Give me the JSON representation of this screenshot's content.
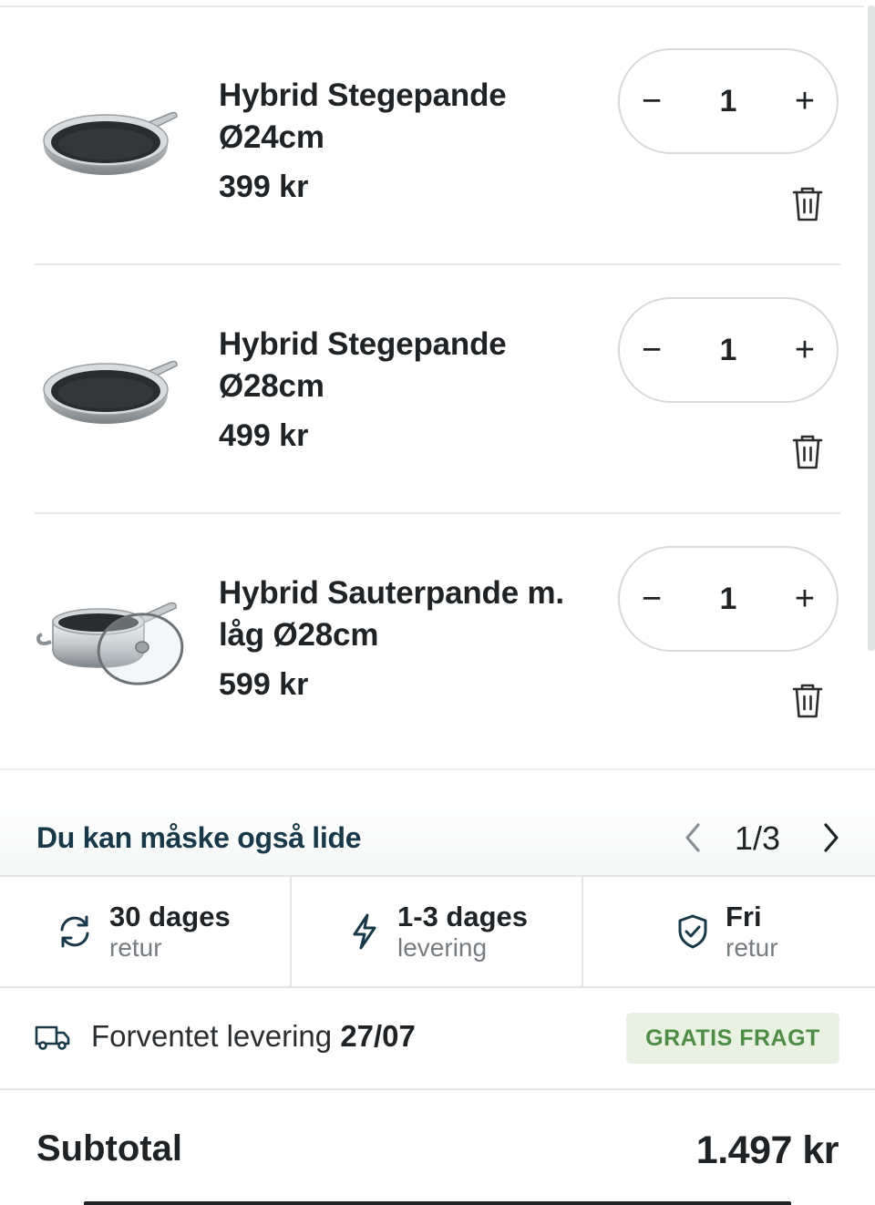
{
  "cart": {
    "items": [
      {
        "title": "Hybrid Stegepande Ø24cm",
        "price": "399 kr",
        "quantity": "1",
        "minus": "−",
        "plus": "+",
        "image": "frying-pan"
      },
      {
        "title": "Hybrid Stegepande Ø28cm",
        "price": "499 kr",
        "quantity": "1",
        "minus": "−",
        "plus": "+",
        "image": "frying-pan"
      },
      {
        "title": "Hybrid Sauterpande m. låg Ø28cm",
        "price": "599 kr",
        "quantity": "1",
        "minus": "−",
        "plus": "+",
        "image": "saute-pan-with-lid"
      }
    ]
  },
  "recommendations": {
    "title": "Du kan måske også lide",
    "page": "1/3"
  },
  "usps": [
    {
      "main": "30 dages",
      "sub": "retur",
      "icon": "refresh-icon"
    },
    {
      "main": "1-3 dages",
      "sub": "levering",
      "icon": "lightning-icon"
    },
    {
      "main": "Fri",
      "sub": "retur",
      "icon": "shield-check-icon"
    }
  ],
  "delivery": {
    "label": "Forventet levering",
    "date": "27/07",
    "badge": "GRATIS FRAGT",
    "icon": "truck-icon"
  },
  "summary": {
    "subtotal_label": "Subtotal",
    "subtotal_value": "1.497 kr"
  },
  "colors": {
    "text": "#1f2326",
    "heading": "#19394a",
    "muted": "#777c80",
    "badge_bg": "#e8f1e2",
    "badge_text": "#4f8c45",
    "border": "#e3e6e7"
  }
}
